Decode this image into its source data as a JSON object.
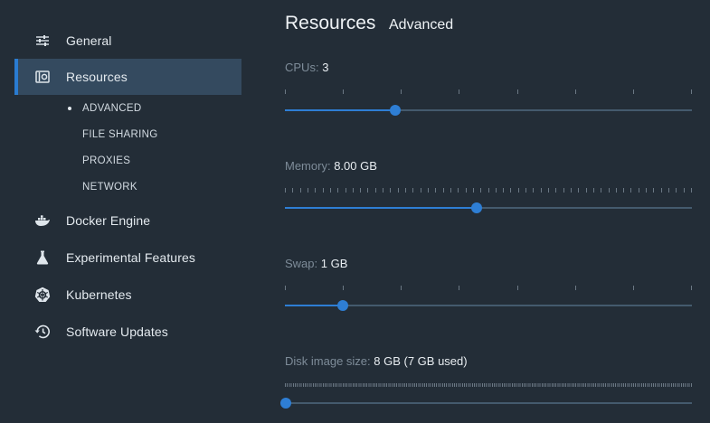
{
  "sidebar": {
    "items": [
      {
        "label": "General",
        "icon": "sliders-icon"
      },
      {
        "label": "Resources",
        "icon": "resources-icon",
        "active": true
      },
      {
        "label": "Docker Engine",
        "icon": "whale-icon"
      },
      {
        "label": "Experimental Features",
        "icon": "flask-icon"
      },
      {
        "label": "Kubernetes",
        "icon": "kubernetes-icon"
      },
      {
        "label": "Software Updates",
        "icon": "history-icon"
      }
    ],
    "resources_subitems": [
      "ADVANCED",
      "FILE SHARING",
      "PROXIES",
      "NETWORK"
    ]
  },
  "main": {
    "title": "Resources",
    "subtitle": "Advanced",
    "cpus": {
      "label": "CPUs:",
      "value": "3",
      "min": 1,
      "max": 8,
      "current": 3
    },
    "memory": {
      "label": "Memory:",
      "value": "8.00 GB",
      "fraction": 0.47
    },
    "swap": {
      "label": "Swap:",
      "value": "1 GB",
      "min": 0,
      "max": 7,
      "current": 1
    },
    "disk": {
      "label": "Disk image size:",
      "value": "8 GB (7 GB used)",
      "fraction": 0.0
    }
  },
  "colors": {
    "accent": "#2e7ed4",
    "background": "#232d37",
    "active_nav": "#344a5f"
  }
}
